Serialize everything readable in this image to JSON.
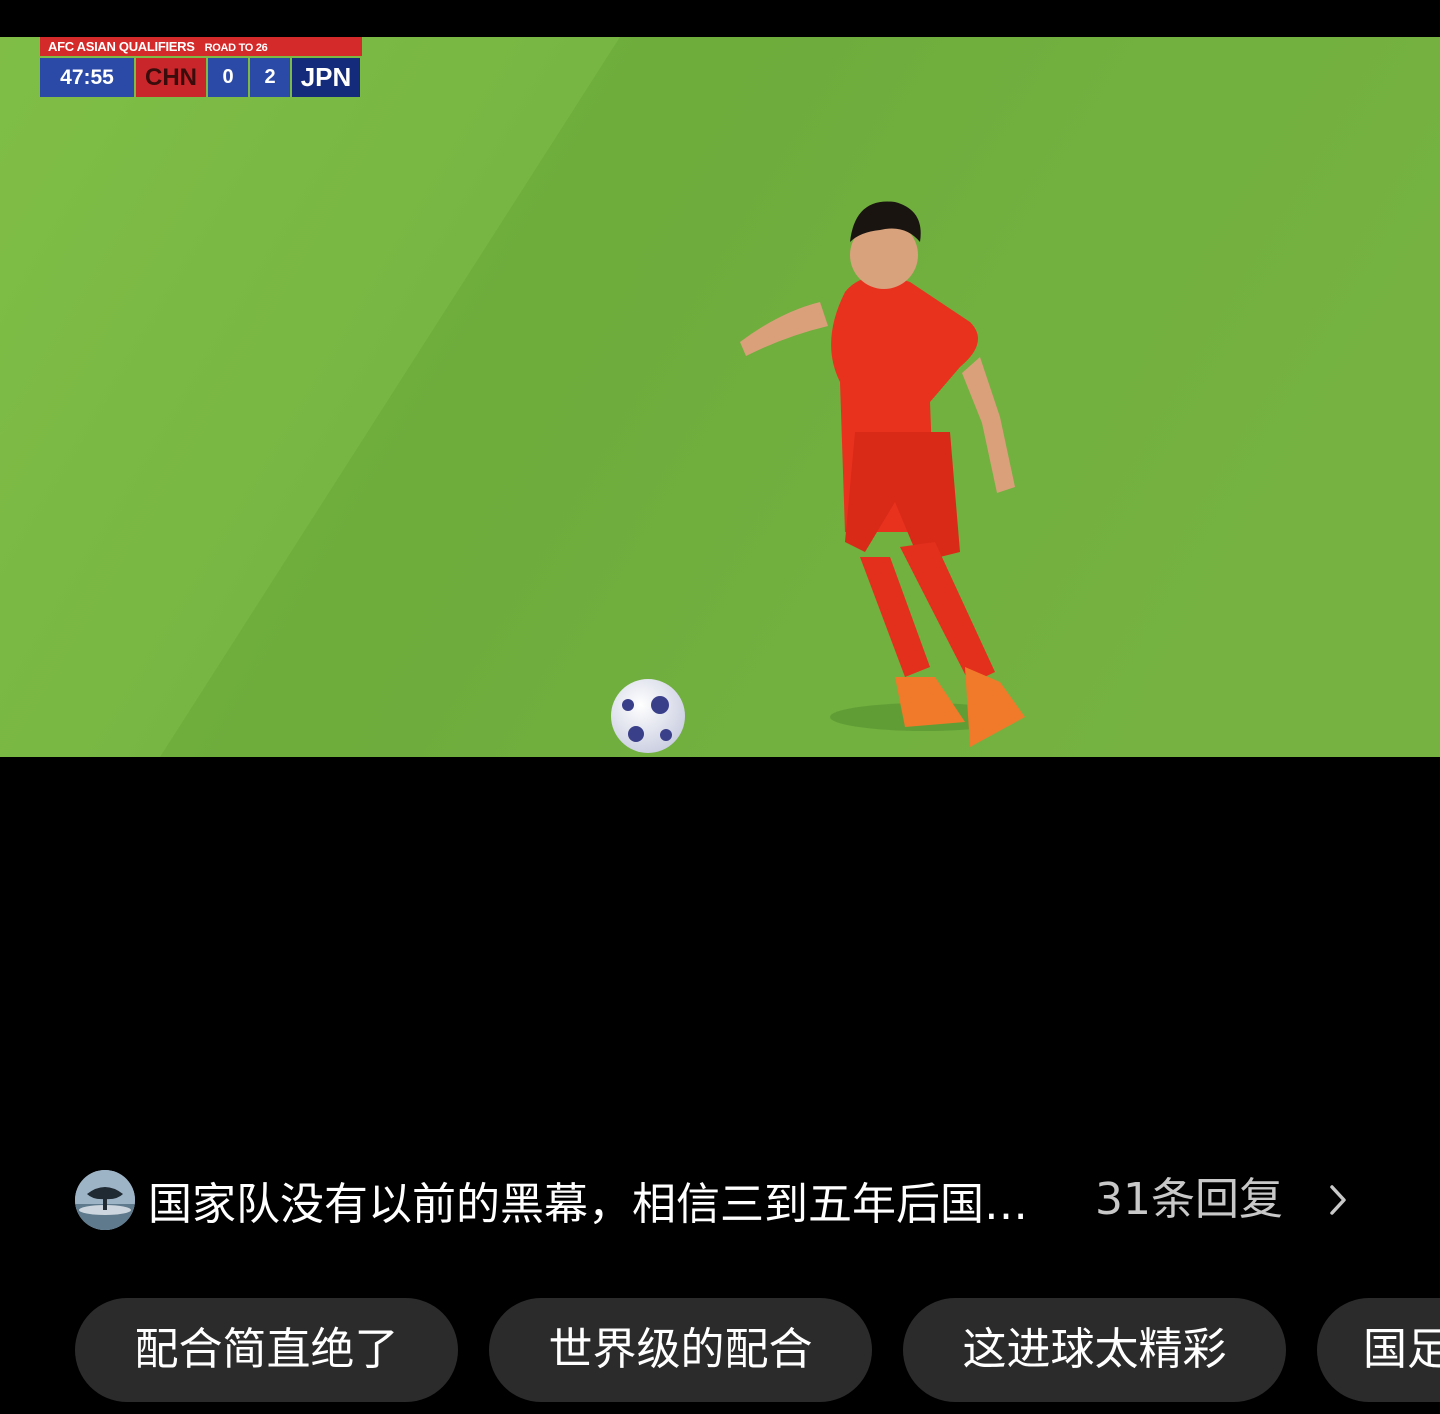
{
  "video": {
    "scorebug": {
      "competition": "AFC ASIAN QUALIFIERS",
      "round": "ROAD TO 26",
      "clock": "47:55",
      "home_team": "CHN",
      "home_score": "0",
      "away_score": "2",
      "away_team": "JPN"
    }
  },
  "comment": {
    "text": "国家队没有以前的黑幕，相信三到五年后国足一定能进世界杯",
    "reply_count": "31条回复",
    "icons": {
      "avatar": "tree-landscape-avatar",
      "more": "chevron-right-icon"
    }
  },
  "chips": [
    {
      "label": "配合简直绝了"
    },
    {
      "label": "世界级的配合"
    },
    {
      "label": "这进球太精彩"
    },
    {
      "label": "国足"
    }
  ],
  "colors": {
    "background": "#000000",
    "chip_background": "#2b2b2b",
    "secondary_text": "#c8c8c8",
    "home_red": "#c8262a",
    "scorebug_blue": "#2b4aa8"
  }
}
